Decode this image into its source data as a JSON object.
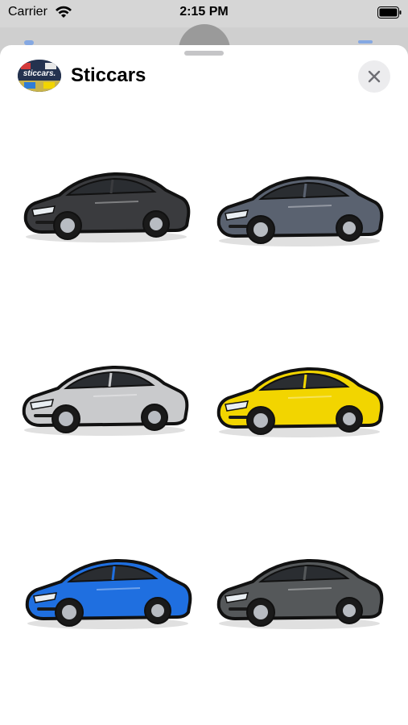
{
  "status_bar": {
    "carrier": "Carrier",
    "time": "2:15 PM",
    "wifi_icon": "wifi-icon",
    "battery_icon": "battery-icon"
  },
  "sheet": {
    "title": "Sticcars",
    "logo_text": "sticcars.",
    "close_icon": "close-icon"
  },
  "stickers": [
    {
      "name": "dark-gray-coupe-sticker",
      "color": "#3a3b3e"
    },
    {
      "name": "gray-compact-coupe-sticker",
      "color": "#5a6270"
    },
    {
      "name": "silver-sports-car-sticker",
      "color": "#c9cacc"
    },
    {
      "name": "yellow-sports-car-sticker",
      "color": "#f2d500"
    },
    {
      "name": "blue-sports-car-sticker",
      "color": "#1f6fe0"
    },
    {
      "name": "graphite-coupe-sticker",
      "color": "#55585a"
    }
  ]
}
